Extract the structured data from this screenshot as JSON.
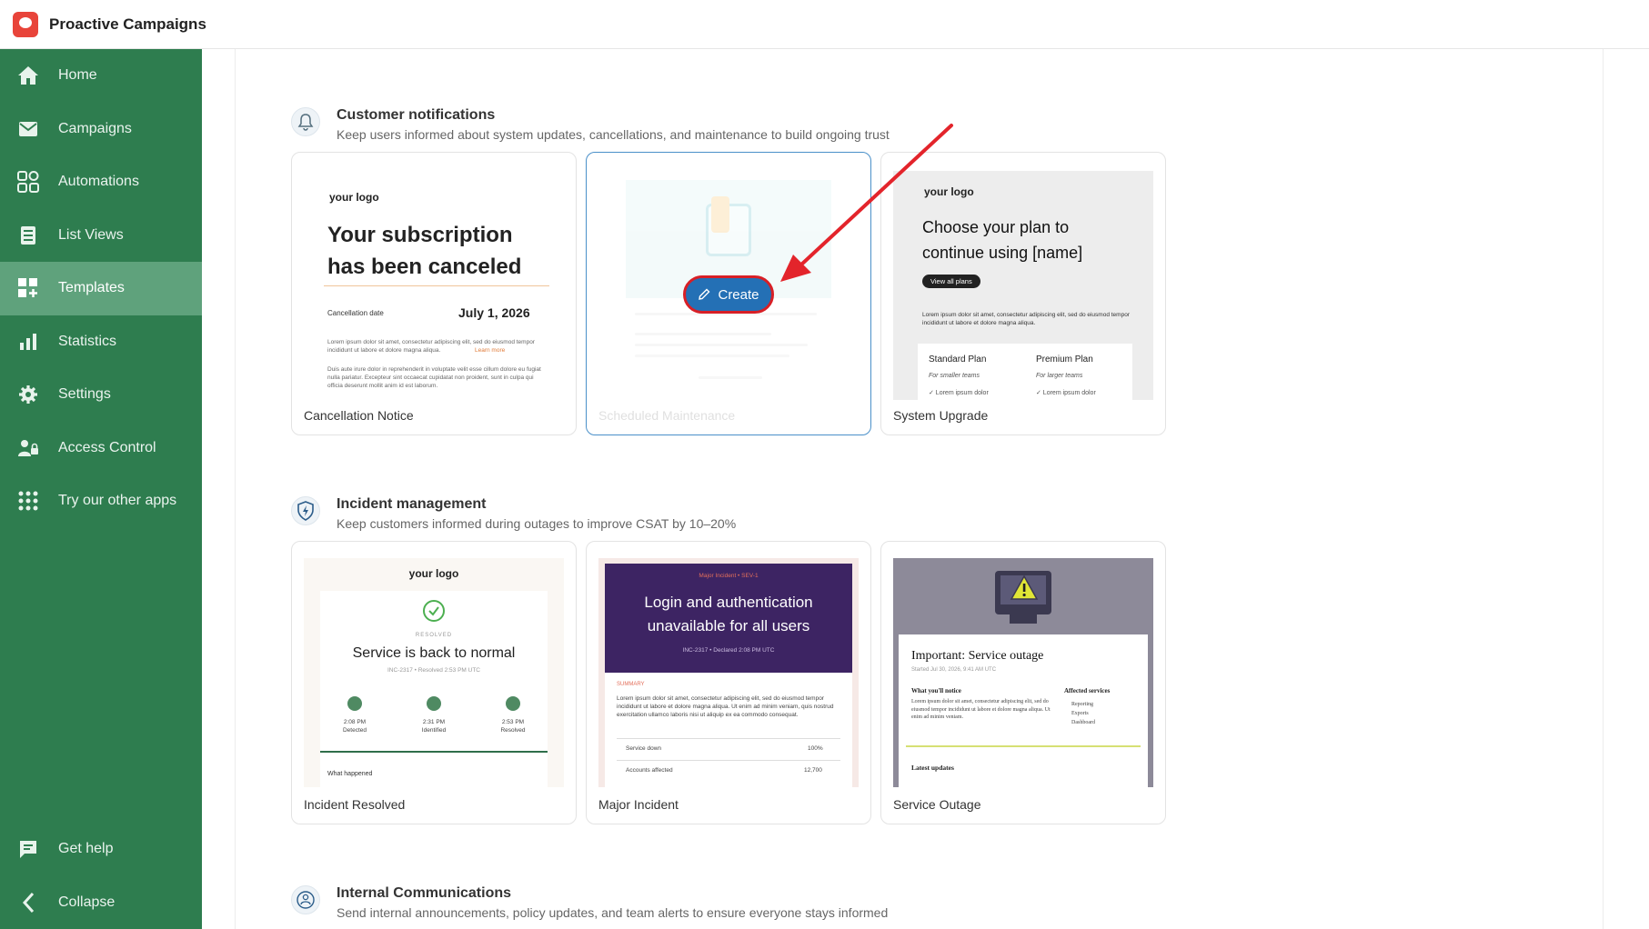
{
  "app": {
    "title": "Proactive Campaigns",
    "logo_icon": "app-logo-icon"
  },
  "sidebar": {
    "items": [
      {
        "label": "Home",
        "icon": "home-icon"
      },
      {
        "label": "Campaigns",
        "icon": "mail-icon"
      },
      {
        "label": "Automations",
        "icon": "automation-icon"
      },
      {
        "label": "List Views",
        "icon": "list-icon"
      },
      {
        "label": "Templates",
        "icon": "templates-icon",
        "active": true
      },
      {
        "label": "Statistics",
        "icon": "bar-chart-icon"
      },
      {
        "label": "Settings",
        "icon": "gear-icon"
      },
      {
        "label": "Access Control",
        "icon": "user-lock-icon"
      },
      {
        "label": "Try our other apps",
        "icon": "grid-icon"
      }
    ],
    "bottom": [
      {
        "label": "Get help",
        "icon": "help-chat-icon"
      },
      {
        "label": "Collapse",
        "icon": "chevron-left-icon"
      }
    ],
    "colors": {
      "background": "#2e7d4f",
      "active": "#5fa27c"
    }
  },
  "sections": [
    {
      "title": "Customer notifications",
      "description": "Keep users informed about system updates, cancellations, and maintenance to build ongoing trust",
      "icon": "bell-icon",
      "cards": [
        {
          "label": "Cancellation Notice",
          "preview": {
            "logo": "your logo",
            "heading_line1": "Your subscription",
            "heading_line2": "has been canceled",
            "date_label": "Cancellation date",
            "date_value": "July 1, 2026",
            "body1": "Lorem ipsum dolor sit amet, consectetur adipiscing elit, sed do eiusmod tempor incididunt ut labore et dolore magna aliqua.",
            "link": "Learn more",
            "body2": "Duis aute irure dolor in reprehenderit in voluptate velit esse cillum dolore eu fugiat nulla pariatur. Excepteur sint occaecat cupidatat non proident, sunt in culpa qui officia deserunt mollit anim id est laborum."
          }
        },
        {
          "label": "Scheduled Maintenance",
          "create_label": "Create",
          "create_icon": "pencil-icon"
        },
        {
          "label": "System Upgrade",
          "preview": {
            "logo": "your logo",
            "heading_line1": "Choose your plan to",
            "heading_line2": "continue using [name]",
            "button": "View all plans",
            "body": "Lorem ipsum dolor sit amet, consectetur adipiscing elit, sed do eiusmod tempor incididunt ut labore et dolore magna aliqua.",
            "plan1": "Standard Plan",
            "plan1_sub": "For smaller teams",
            "plan2": "Premium Plan",
            "plan2_sub": "For larger teams",
            "plan_item": "✓ Lorem ipsum dolor"
          }
        }
      ]
    },
    {
      "title": "Incident management",
      "description": "Keep customers informed during outages to improve CSAT by 10–20%",
      "icon": "shield-bolt-icon",
      "cards": [
        {
          "label": "Incident Resolved",
          "preview": {
            "logo": "your logo",
            "status": "RESOLVED",
            "heading": "Service is back to normal",
            "sub": "INC-2317 • Resolved 2:53 PM UTC",
            "steps": [
              {
                "time": "2:08 PM",
                "name": "Detected"
              },
              {
                "time": "2:31 PM",
                "name": "Identified"
              },
              {
                "time": "2:53 PM",
                "name": "Resolved"
              }
            ],
            "section": "What happened"
          }
        },
        {
          "label": "Major Incident",
          "preview": {
            "tag": "Major Incident • SEV-1",
            "heading_line1": "Login and authentication",
            "heading_line2": "unavailable for all users",
            "sub": "INC-2317 • Declared 2:08 PM UTC",
            "summary_label": "SUMMARY",
            "body": "Lorem ipsum dolor sit amet, consectetur adipiscing elit, sed do eiusmod tempor incididunt ut labore et dolore magna aliqua. Ut enim ad minim veniam, quis nostrud exercitation ullamco laboris nisi ut aliquip ex ea commodo consequat.",
            "row1_label": "Service down",
            "row1_value": "100%",
            "row2_label": "Accounts affected",
            "row2_value": "12,700"
          }
        },
        {
          "label": "Service Outage",
          "preview": {
            "heading": "Important: Service outage",
            "sub": "Started Jul 30, 2026, 9:41 AM UTC",
            "col1_title": "What you'll notice",
            "col1_body": "Lorem ipsum dolor sit amet, consectetur adipiscing elit, sed do eiusmod tempor incididunt ut labore et dolore magna aliqua. Ut enim ad minim veniam.",
            "col2_title": "Affected services",
            "col2_items": [
              "Reporting",
              "Exports",
              "Dashboard"
            ],
            "section": "Latest updates"
          }
        }
      ]
    },
    {
      "title": "Internal Communications",
      "description": "Send internal announcements, policy updates, and team alerts to ensure everyone stays informed",
      "icon": "team-icon",
      "cards": []
    }
  ],
  "colors": {
    "accent_blue": "#2470b5",
    "annotation_red": "#d81f26",
    "purple_header": "#3d2463",
    "warning_yellow": "#e0e636"
  }
}
